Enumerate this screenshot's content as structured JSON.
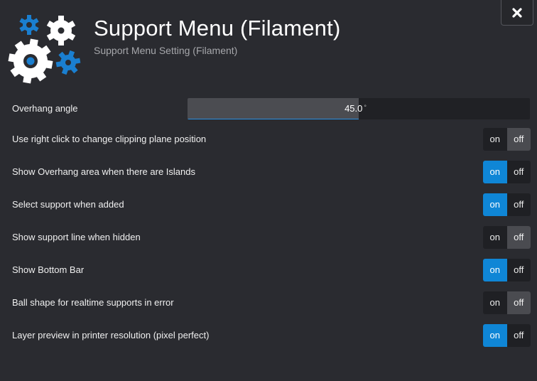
{
  "header": {
    "title": "Support Menu (Filament)",
    "subtitle": "Support Menu Setting (Filament)",
    "close_label": "✖"
  },
  "logo": {
    "icon": "gears-icon",
    "colors": {
      "white": "#ffffff",
      "blue": "#1a7fd0",
      "dark": "#2a2b30"
    }
  },
  "settings": {
    "overhang": {
      "label": "Overhang angle",
      "value": "45.0",
      "unit": "°",
      "fill_fraction": 0.5
    },
    "toggles": [
      {
        "label": "Use right click to change clipping plane position",
        "on": "on",
        "off": "off",
        "state": "off"
      },
      {
        "label": "Show Overhang area when there are Islands",
        "on": "on",
        "off": "off",
        "state": "on"
      },
      {
        "label": "Select support when added",
        "on": "on",
        "off": "off",
        "state": "on"
      },
      {
        "label": "Show support line when hidden",
        "on": "on",
        "off": "off",
        "state": "off"
      },
      {
        "label": "Show Bottom Bar",
        "on": "on",
        "off": "off",
        "state": "on"
      },
      {
        "label": "Ball shape for realtime supports in error",
        "on": "on",
        "off": "off",
        "state": "off"
      },
      {
        "label": "Layer preview in printer resolution (pixel perfect)",
        "on": "on",
        "off": "off",
        "state": "on"
      }
    ]
  },
  "colors": {
    "background": "#2a2b30",
    "accent": "#0f86d6",
    "toggle_off_selected": "#4a4b50"
  }
}
